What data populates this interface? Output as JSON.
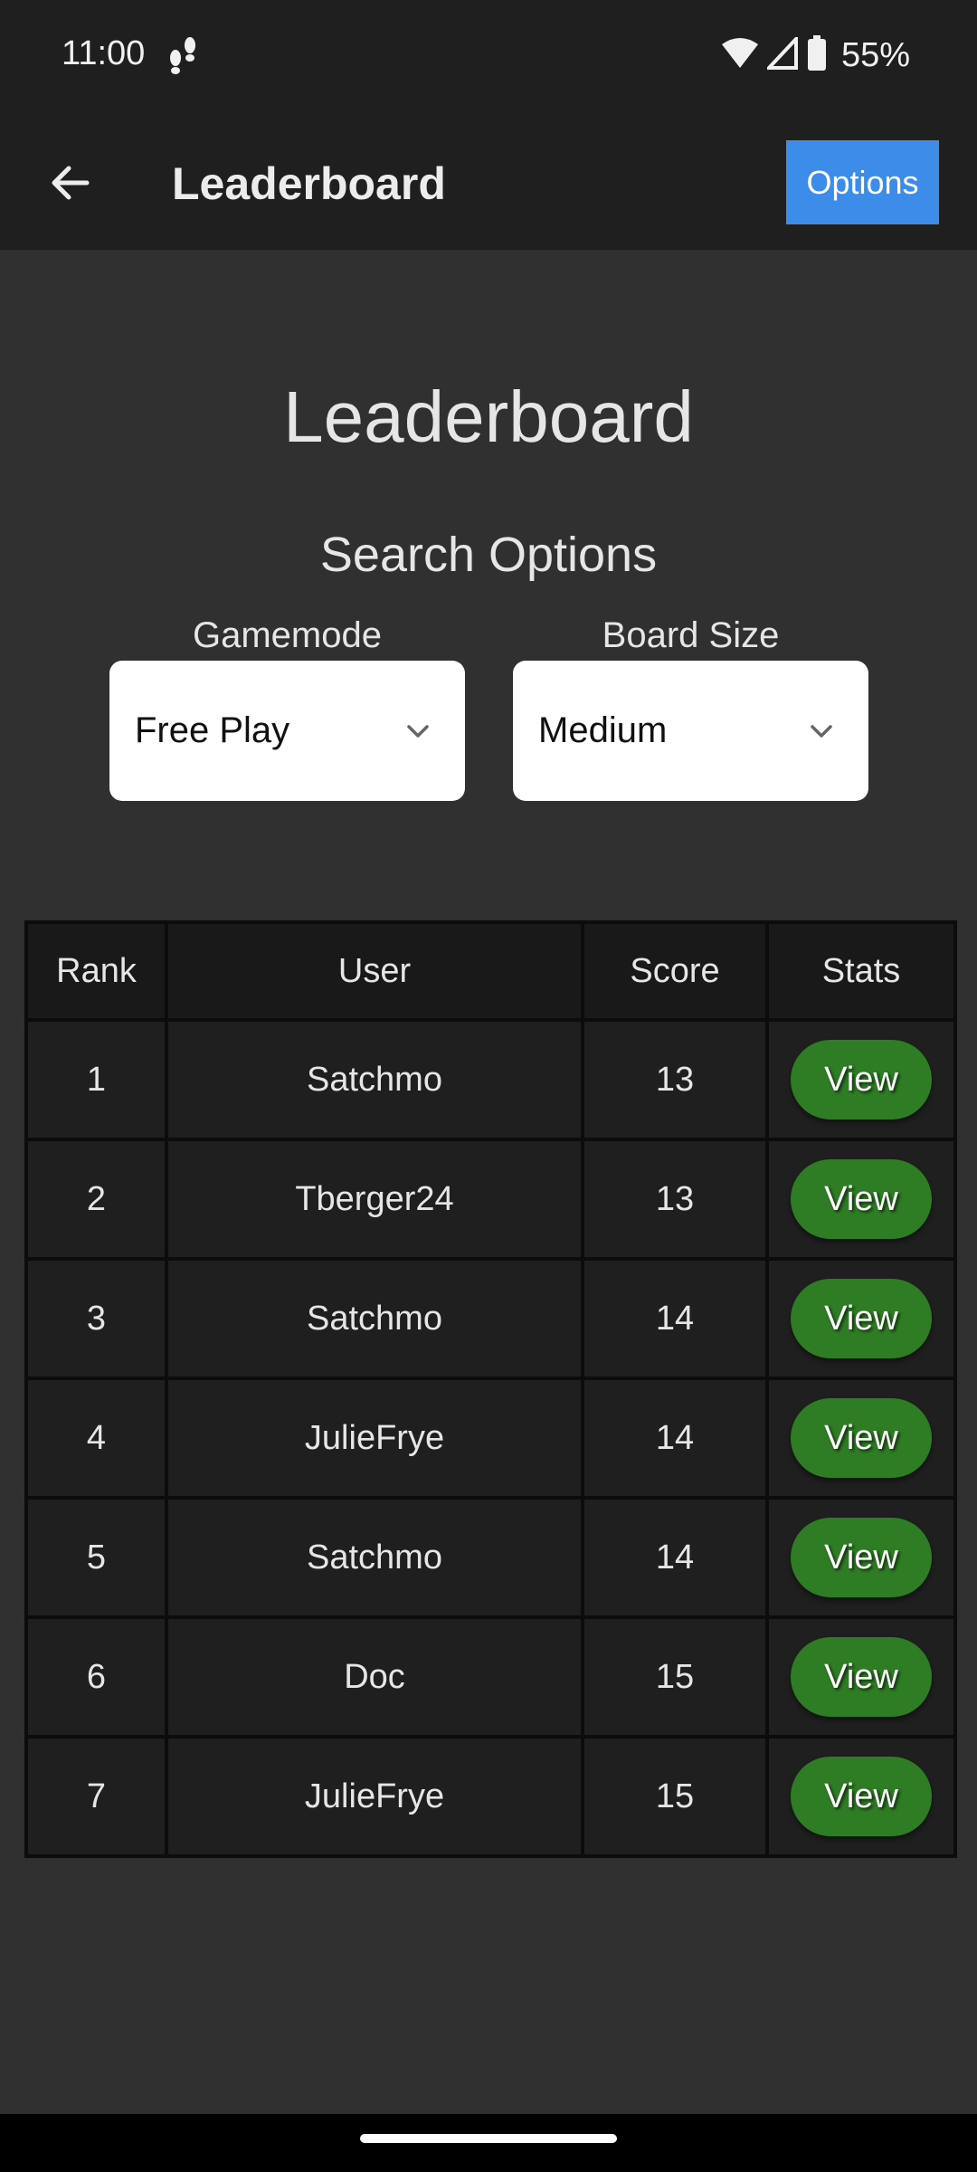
{
  "status_bar": {
    "time": "11:00",
    "battery": "55%",
    "icons": [
      "footprints-icon",
      "wifi-icon",
      "cell-signal-icon",
      "battery-icon"
    ]
  },
  "app_bar": {
    "title": "Leaderboard",
    "back_icon": "arrow-left-icon",
    "options_label": "Options"
  },
  "main": {
    "title": "Leaderboard",
    "search_title": "Search Options",
    "filters": [
      {
        "label": "Gamemode",
        "value": "Free Play"
      },
      {
        "label": "Board Size",
        "value": "Medium"
      }
    ]
  },
  "table": {
    "headers": [
      "Rank",
      "User",
      "Score",
      "Stats"
    ],
    "view_label": "View",
    "rows": [
      {
        "rank": "1",
        "user": "Satchmo",
        "score": "13"
      },
      {
        "rank": "2",
        "user": "Tberger24",
        "score": "13"
      },
      {
        "rank": "3",
        "user": "Satchmo",
        "score": "14"
      },
      {
        "rank": "4",
        "user": "JulieFrye",
        "score": "14"
      },
      {
        "rank": "5",
        "user": "Satchmo",
        "score": "14"
      },
      {
        "rank": "6",
        "user": "Doc",
        "score": "15"
      },
      {
        "rank": "7",
        "user": "JulieFrye",
        "score": "15"
      }
    ]
  },
  "colors": {
    "background": "#303030",
    "app_bar": "#1f1f1f",
    "options_button": "#3b8de9",
    "view_button": "#2e7d24"
  }
}
